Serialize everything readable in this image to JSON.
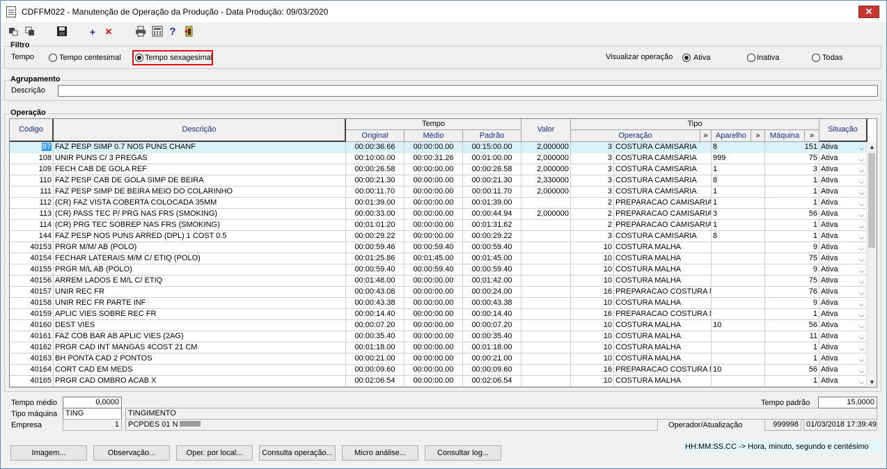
{
  "window": {
    "title": "CDFFM022 - Manutenção de Operação da Produção - Data Produção: 09/03/2020",
    "close": "✕"
  },
  "toolbar": {
    "icons": [
      "first-record-icon",
      "last-record-icon",
      "save-icon",
      "add-icon",
      "delete-icon",
      "print-icon",
      "calculator-icon",
      "help-icon",
      "exit-icon"
    ],
    "add": "+",
    "delete": "✕",
    "help": "?"
  },
  "filtro": {
    "label": "Filtro",
    "tempo_label": "Tempo",
    "centesimal": "Tempo centesimal",
    "sexagesimal": "Tempo sexagesimal",
    "selected": "Tempo sexagesimal",
    "visualizar_label": "Visualizar operação",
    "ativa": "Ativa",
    "inativa": "Inativa",
    "todas": "Todas",
    "visualizar_selected": "Ativa"
  },
  "agrupamento": {
    "label": "Agrupamento",
    "descricao_label": "Descrição",
    "descricao_value": ""
  },
  "operacao": {
    "label": "Operação",
    "headers": {
      "codigo": "Código",
      "descricao": "Descrição",
      "tempo": "Tempo",
      "original": "Original",
      "medio": "Médio",
      "padrao": "Padrão",
      "valor": "Valor",
      "tipo": "Tipo",
      "operacao": "Operação",
      "aparelho": "Aparelho",
      "maquina": "Máquina",
      "situacao": "Situação",
      "expand": "»"
    },
    "rows": [
      {
        "codigo": "97",
        "descricao": "FAZ PESP SIMP 0.7 NOS PUNS CHANF",
        "original": "00:00:36.66",
        "medio": "00:00:00.00",
        "padrao": "00:15:00.00",
        "valor": "2,000000",
        "op_num": "3",
        "op_desc": "COSTURA CAMISARIA",
        "aparelho": "8",
        "maquina": "151",
        "situacao": "Ativa"
      },
      {
        "codigo": "108",
        "descricao": "UNIR PUNS C/ 3 PREGAS",
        "original": "00:10:00.00",
        "medio": "00:00:31.26",
        "padrao": "00:01:00.00",
        "valor": "2,000000",
        "op_num": "3",
        "op_desc": "COSTURA CAMISARIA",
        "aparelho": "999",
        "maquina": "75",
        "situacao": "Ativa"
      },
      {
        "codigo": "109",
        "descricao": "FECH CAB DE GOLA REF",
        "original": "00:00:26.58",
        "medio": "00:00:00.00",
        "padrao": "00:00:26.58",
        "valor": "2,000000",
        "op_num": "3",
        "op_desc": "COSTURA CAMISARIA",
        "aparelho": "1",
        "maquina": "3",
        "situacao": "Ativa"
      },
      {
        "codigo": "110",
        "descricao": "FAZ PESP CAB DE GOLA SIMP DE BEIRA",
        "original": "00:00:21.30",
        "medio": "00:00:00.00",
        "padrao": "00:00:21.30",
        "valor": "2,330000",
        "op_num": "3",
        "op_desc": "COSTURA CAMISARIA",
        "aparelho": "8",
        "maquina": "1",
        "situacao": "Ativa"
      },
      {
        "codigo": "111",
        "descricao": "FAZ PESP SIMP DE BEIRA MEIO DO COLARINHO",
        "original": "00:00:11.70",
        "medio": "00:00:00.00",
        "padrao": "00:00:11.70",
        "valor": "2,000000",
        "op_num": "3",
        "op_desc": "COSTURA CAMISARIA",
        "aparelho": "1",
        "maquina": "1",
        "situacao": "Ativa"
      },
      {
        "codigo": "112",
        "descricao": "(CR) FAZ VISTA COBERTA COLOCADA 35MM",
        "original": "00:01:39.00",
        "medio": "00:00:00.00",
        "padrao": "00:01:39.00",
        "valor": "",
        "op_num": "2",
        "op_desc": "PREPARACAO CAMISARIA",
        "aparelho": "1",
        "maquina": "1",
        "situacao": "Ativa"
      },
      {
        "codigo": "113",
        "descricao": "(CR) PASS TEC P/ PRG NAS FRS (SMOKING)",
        "original": "00:00:33.00",
        "medio": "00:00:00.00",
        "padrao": "00:00:44.94",
        "valor": "2,000000",
        "op_num": "2",
        "op_desc": "PREPARACAO CAMISARIA",
        "aparelho": "3",
        "maquina": "56",
        "situacao": "Ativa"
      },
      {
        "codigo": "114",
        "descricao": "(CR) PRG TEC SOBREP NAS FRS (SMOKING)",
        "original": "00:01:01.20",
        "medio": "00:00:00.00",
        "padrao": "00:01:31.62",
        "valor": "",
        "op_num": "2",
        "op_desc": "PREPARACAO CAMISARIA",
        "aparelho": "1",
        "maquina": "1",
        "situacao": "Ativa"
      },
      {
        "codigo": "144",
        "descricao": "FAZ PESP NOS PUNS ARRED (DPL) 1 COST 0.5",
        "original": "00:00:29.22",
        "medio": "00:00:00.00",
        "padrao": "00:00:29.22",
        "valor": "",
        "op_num": "3",
        "op_desc": "COSTURA CAMISARIA",
        "aparelho": "8",
        "maquina": "1",
        "situacao": "Ativa"
      },
      {
        "codigo": "40153",
        "descricao": "PRGR M/M/ AB (POLO)",
        "original": "00:00:59.46",
        "medio": "00:00:59.40",
        "padrao": "00:00:59.40",
        "valor": "",
        "op_num": "10",
        "op_desc": "COSTURA MALHA",
        "aparelho": "",
        "maquina": "9",
        "situacao": "Ativa"
      },
      {
        "codigo": "40154",
        "descricao": "FECHAR LATERAIS M/M C/ ETIQ (POLO)",
        "original": "00:01:25.86",
        "medio": "00:01:45.00",
        "padrao": "00:01:45.00",
        "valor": "",
        "op_num": "10",
        "op_desc": "COSTURA MALHA",
        "aparelho": "",
        "maquina": "75",
        "situacao": "Ativa"
      },
      {
        "codigo": "40155",
        "descricao": "PRGR M/L AB (POLO)",
        "original": "00:00:59.40",
        "medio": "00:00:59.40",
        "padrao": "00:00:59.40",
        "valor": "",
        "op_num": "10",
        "op_desc": "COSTURA MALHA",
        "aparelho": "",
        "maquina": "9",
        "situacao": "Ativa"
      },
      {
        "codigo": "40156",
        "descricao": "ARREM LADOS E M/L C/ ETIQ",
        "original": "00:01:48.00",
        "medio": "00:00:00.00",
        "padrao": "00:01:42.00",
        "valor": "",
        "op_num": "10",
        "op_desc": "COSTURA MALHA",
        "aparelho": "",
        "maquina": "75",
        "situacao": "Ativa"
      },
      {
        "codigo": "40157",
        "descricao": "UNIR REC FR",
        "original": "00:00:43.08",
        "medio": "00:00:00.00",
        "padrao": "00:00:24.00",
        "valor": "",
        "op_num": "16",
        "op_desc": "PREPARACAO COSTURA MALHA",
        "aparelho": "",
        "maquina": "76",
        "situacao": "Ativa"
      },
      {
        "codigo": "40158",
        "descricao": "UNIR REC FR PARTE INF",
        "original": "00:00:43.38",
        "medio": "00:00:00.00",
        "padrao": "00:00:43.38",
        "valor": "",
        "op_num": "10",
        "op_desc": "COSTURA MALHA",
        "aparelho": "",
        "maquina": "9",
        "situacao": "Ativa"
      },
      {
        "codigo": "40159",
        "descricao": "APLIC VIES SOBRE REC FR",
        "original": "00:00:14.40",
        "medio": "00:00:00.00",
        "padrao": "00:00:14.40",
        "valor": "",
        "op_num": "16",
        "op_desc": "PREPARACAO COSTURA MALHA",
        "aparelho": "",
        "maquina": "1",
        "situacao": "Ativa"
      },
      {
        "codigo": "40160",
        "descricao": "DEST VIES",
        "original": "00:00:07.20",
        "medio": "00:00:00.00",
        "padrao": "00:00:07.20",
        "valor": "",
        "op_num": "10",
        "op_desc": "COSTURA MALHA",
        "aparelho": "10",
        "maquina": "56",
        "situacao": "Ativa"
      },
      {
        "codigo": "40161",
        "descricao": "FAZ COB BAR AB APLIC VIES (2AG)",
        "original": "00:00:35.40",
        "medio": "00:00:00.00",
        "padrao": "00:00:35.40",
        "valor": "",
        "op_num": "10",
        "op_desc": "COSTURA MALHA",
        "aparelho": "",
        "maquina": "11",
        "situacao": "Ativa"
      },
      {
        "codigo": "40162",
        "descricao": "PRGR CAD INT MANGAS 4COST 21 CM",
        "original": "00:01:18.00",
        "medio": "00:00:00.00",
        "padrao": "00:01:18.00",
        "valor": "",
        "op_num": "10",
        "op_desc": "COSTURA MALHA",
        "aparelho": "",
        "maquina": "1",
        "situacao": "Ativa"
      },
      {
        "codigo": "40163",
        "descricao": "BH PONTA CAD 2 PONTOS",
        "original": "00:00:21.00",
        "medio": "00:00:00.00",
        "padrao": "00:00:21.00",
        "valor": "",
        "op_num": "10",
        "op_desc": "COSTURA MALHA",
        "aparelho": "",
        "maquina": "1",
        "situacao": "Ativa"
      },
      {
        "codigo": "40164",
        "descricao": "CORT CAD EM MEDS",
        "original": "00:00:09.60",
        "medio": "00:00:00.00",
        "padrao": "00:00:09.60",
        "valor": "",
        "op_num": "16",
        "op_desc": "PREPARACAO COSTURA MALHA",
        "aparelho": "10",
        "maquina": "56",
        "situacao": "Ativa"
      },
      {
        "codigo": "40165",
        "descricao": "PRGR CAD OMBRO ACAB X",
        "original": "00:02:06.54",
        "medio": "00:00:00.00",
        "padrao": "00:02:06.54",
        "valor": "",
        "op_num": "10",
        "op_desc": "COSTURA MALHA",
        "aparelho": "",
        "maquina": "1",
        "situacao": "Ativa"
      }
    ]
  },
  "footer": {
    "tempo_medio_label": "Tempo médio",
    "tempo_medio_value": "0,0000",
    "tipo_maquina_label": "Tipo máquina",
    "tipo_maquina_value": "TING",
    "tipo_maquina_desc": "TINGIMENTO",
    "empresa_label": "Empresa",
    "empresa_value": "1",
    "empresa_desc": "PCPDES 01 N",
    "tempo_padrao_label": "Tempo padrão",
    "tempo_padrao_value": "15,0000",
    "operador_label": "Operador/Atualização",
    "operador_value": "999998",
    "atualizacao_value": "01/03/2018 17:39:49"
  },
  "buttons": {
    "imagem": "Imagem...",
    "observacao": "Observação...",
    "oper_local": "Oper. por local...",
    "consulta": "Consulta operação...",
    "micro": "Micro análise...",
    "log": "Consultar log..."
  },
  "hint": "HH:MM:SS.CC -> Hora, minuto, segundo e centésimo"
}
